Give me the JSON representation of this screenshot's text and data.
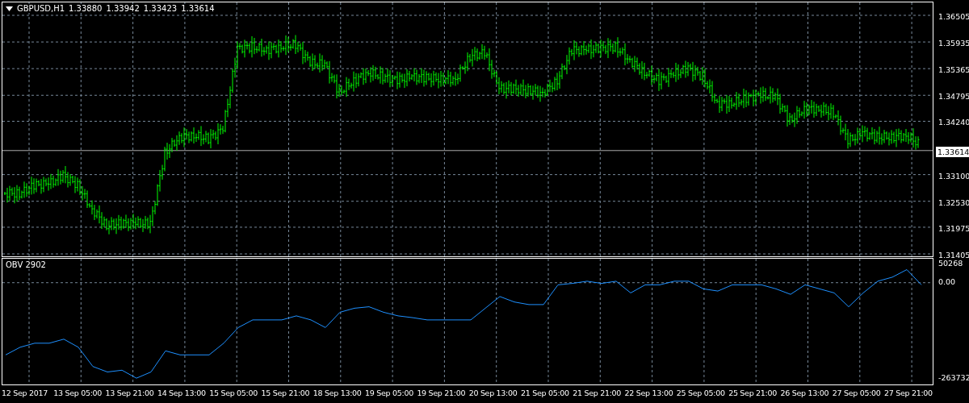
{
  "header": {
    "symbol": "GBPUSD,H1",
    "quotes": [
      "1.33880",
      "1.33942",
      "1.33423",
      "1.33614"
    ]
  },
  "price_chart": {
    "current_price": "1.33614",
    "price_labels": [
      "1.36505",
      "1.35935",
      "1.35365",
      "1.34795",
      "1.34240",
      "1.33100",
      "1.32530",
      "1.31975",
      "1.31405"
    ]
  },
  "obv_chart": {
    "label": "OBV 2902",
    "chart_data": {
      "type": "line",
      "grid": true,
      "ylim": [
        -279211,
        65747
      ],
      "yticks": [
        {
          "value": 50268,
          "label": "50268"
        },
        {
          "value": 0,
          "label": "0.00"
        },
        {
          "value": -263732,
          "label": "-263732"
        }
      ],
      "series": [
        {
          "color": "#1e90ff",
          "values": [
            -198000,
            -177000,
            -166000,
            -166000,
            -155000,
            -177000,
            -230000,
            -245000,
            -240000,
            -262000,
            -245000,
            -187000,
            -198000,
            -198000,
            -198000,
            -166000,
            -123000,
            -102000,
            -102000,
            -102000,
            -91000,
            -102000,
            -123000,
            -81000,
            -70000,
            -66000,
            -81000,
            -91000,
            -96000,
            -102000,
            -102000,
            -102000,
            -102000,
            -70000,
            -38000,
            -53000,
            -60000,
            -60000,
            -6000,
            -2000,
            4000,
            -2000,
            4000,
            -28000,
            -6000,
            -6000,
            4000,
            4000,
            -17000,
            -23000,
            -6000,
            -6000,
            -6000,
            -17000,
            -32000,
            -6000,
            -17000,
            -28000,
            -66000,
            -28000,
            4000,
            15000,
            36000,
            -6000
          ]
        }
      ]
    }
  },
  "time_axis": [
    "12 Sep 2017",
    "13 Sep 05:00",
    "13 Sep 21:00",
    "14 Sep 13:00",
    "15 Sep 05:00",
    "15 Sep 21:00",
    "18 Sep 13:00",
    "19 Sep 05:00",
    "19 Sep 21:00",
    "20 Sep 13:00",
    "21 Sep 05:00",
    "21 Sep 21:00",
    "22 Sep 13:00",
    "25 Sep 05:00",
    "25 Sep 21:00",
    "26 Sep 13:00",
    "27 Sep 05:00",
    "27 Sep 21:00"
  ]
}
